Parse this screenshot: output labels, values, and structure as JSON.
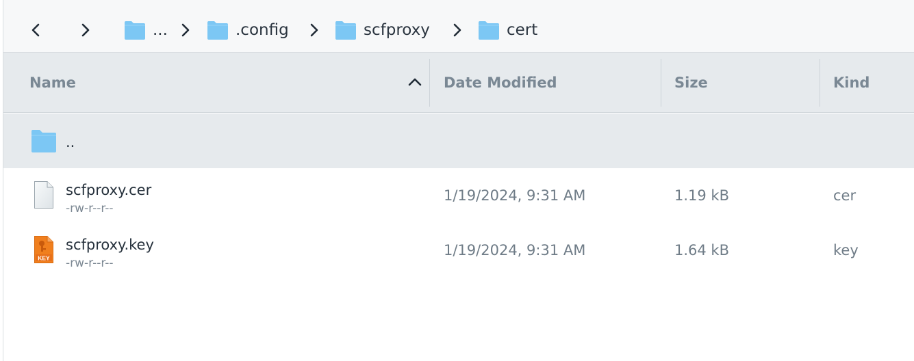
{
  "breadcrumb": {
    "back_icon": "chevron-left-icon",
    "forward_icon": "chevron-right-icon",
    "items": [
      {
        "label": "...",
        "icon": "folder-icon"
      },
      {
        "label": ".config",
        "icon": "folder-icon"
      },
      {
        "label": "scfproxy",
        "icon": "folder-icon"
      },
      {
        "label": "cert",
        "icon": "folder-icon"
      }
    ]
  },
  "columns": {
    "name": "Name",
    "date_modified": "Date Modified",
    "size": "Size",
    "kind": "Kind",
    "sort": {
      "column": "Name",
      "direction": "ascending",
      "icon": "chevron-up-icon"
    }
  },
  "rows": [
    {
      "name": "..",
      "icon": "folder-icon"
    },
    {
      "name": "scfproxy.cer",
      "permissions": "-rw-r--r--",
      "date_modified": "1/19/2024, 9:31 AM",
      "size": "1.19 kB",
      "kind": "cer",
      "icon": "certificate-file-icon"
    },
    {
      "name": "scfproxy.key",
      "permissions": "-rw-r--r--",
      "date_modified": "1/19/2024, 9:31 AM",
      "size": "1.64 kB",
      "kind": "key",
      "icon": "key-file-icon",
      "icon_badge": "KEY"
    }
  ],
  "colors": {
    "folder": "#7cc7f4",
    "header_bg": "#e6eaed",
    "key_icon": "#f07f1e",
    "text_primary": "#26313c",
    "text_secondary": "#6f7c87"
  }
}
